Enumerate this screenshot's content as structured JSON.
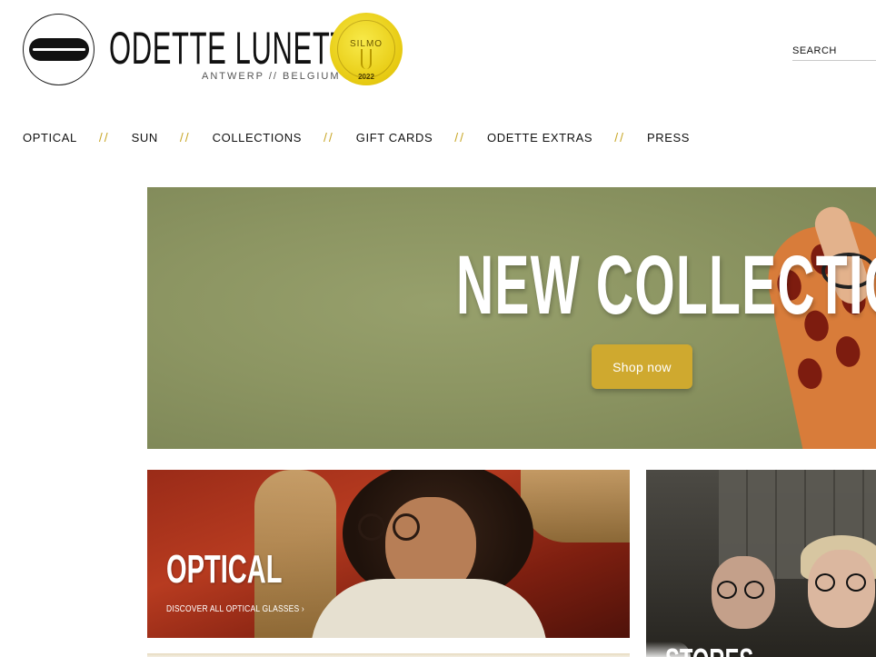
{
  "header": {
    "brand_name": "ODETTE LUNETTES",
    "brand_location": "ANTWERP // BELGIUM",
    "badge": {
      "label": "SILMO",
      "year": "2022"
    },
    "search": {
      "placeholder": "SEARCH",
      "value": ""
    }
  },
  "nav": {
    "separator": "//",
    "items": [
      {
        "label": "OPTICAL"
      },
      {
        "label": "SUN"
      },
      {
        "label": "COLLECTIONS"
      },
      {
        "label": "GIFT CARDS"
      },
      {
        "label": "ODETTE EXTRAS"
      },
      {
        "label": "PRESS"
      }
    ]
  },
  "hero": {
    "title": "NEW COLLECTION",
    "button_label": "Shop now"
  },
  "tiles": {
    "optical": {
      "title": "OPTICAL",
      "link": "DISCOVER ALL OPTICAL GLASSES ›"
    },
    "stores": {
      "title": "STORES"
    }
  },
  "colors": {
    "accent_gold": "#cfa92f",
    "nav_separator": "#c9a82a",
    "hero_background": "#8c9562"
  }
}
